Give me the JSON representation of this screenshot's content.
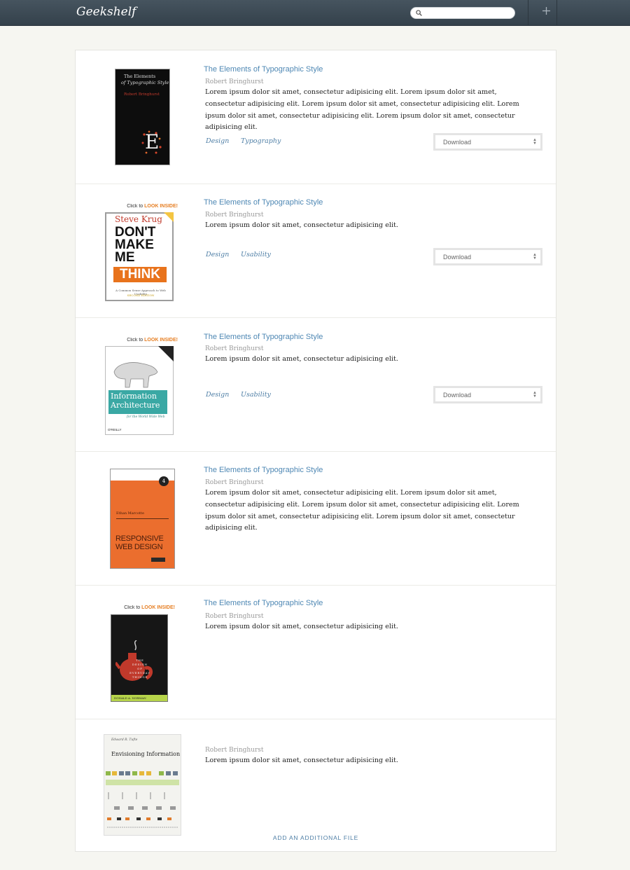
{
  "header": {
    "logo": "Geekshelf",
    "search_placeholder": "",
    "add_icon": "plus-icon",
    "search_icon": "search-icon"
  },
  "books": [
    {
      "title": "The Elements of Typographic Style",
      "author": "Robert Bringhurst",
      "description": "Lorem ipsum dolor sit amet, consectetur adipisicing elit. Lorem ipsum dolor sit amet, consectetur adipisicing elit. Lorem ipsum dolor sit amet, consectetur adipisicing elit. Lorem ipsum dolor sit amet, consectetur adipisicing elit. Lorem ipsum dolor sit amet, consectetur adipisicing elit.",
      "tags": [
        "Design",
        "Typography"
      ],
      "download_label": "Download",
      "cover": {
        "title_line1": "The Elements",
        "title_line2": "of Typographic Style",
        "author": "Robert Bringhurst"
      }
    },
    {
      "title": "The Elements of Typographic Style",
      "author": "Robert Bringhurst",
      "description": "Lorem ipsum dolor sit amet, consectetur adipisicing elit.",
      "tags": [
        "Design",
        "Usability"
      ],
      "download_label": "Download",
      "cover": {
        "banner_prefix": "Click to ",
        "banner_highlight": "LOOK INSIDE!",
        "author": "Steve Krug",
        "line1": "DON'T",
        "line2": "MAKE",
        "line3": "ME",
        "line4": "THINK",
        "subtitle": "A Common Sense Approach to Web Usability",
        "edition": "SECOND EDITION"
      }
    },
    {
      "title": "The Elements of Typographic Style",
      "author": "Robert Bringhurst",
      "description": "Lorem ipsum dolor sit amet, consectetur adipisicing elit.",
      "tags": [
        "Design",
        "Usability"
      ],
      "download_label": "Download",
      "cover": {
        "banner_prefix": "Click to ",
        "banner_highlight": "LOOK INSIDE!",
        "line1": "Information",
        "line2": "Architecture",
        "subtitle": "for the World Wide Web",
        "publisher": "O'REILLY"
      }
    },
    {
      "title": "The Elements of Typographic Style",
      "author": "Robert Bringhurst",
      "description": "Lorem ipsum dolor sit amet, consectetur adipisicing elit. Lorem ipsum dolor sit amet, consectetur adipisicing elit. Lorem ipsum dolor sit amet, consectetur adipisicing elit. Lorem ipsum dolor sit amet, consectetur adipisicing elit. Lorem ipsum dolor sit amet, consectetur adipisicing elit.",
      "tags": [],
      "download_label": "",
      "cover": {
        "badge": "4",
        "author": "Ethan Marcotte",
        "line1": "RESPONSIVE",
        "line2": "WEB DESIGN"
      }
    },
    {
      "title": "The Elements of Typographic Style",
      "author": "Robert Bringhurst",
      "description": "Lorem ipsum dolor sit amet, consectetur adipisicing elit.",
      "tags": [],
      "download_label": "",
      "cover": {
        "banner_prefix": "Click to ",
        "banner_highlight": "LOOK INSIDE!",
        "vertical_text": "THE DESIGN OF EVERYDAY THINGS",
        "author": "DONALD A. NORMAN"
      }
    },
    {
      "title": "",
      "author": "Robert Bringhurst",
      "description": "Lorem ipsum dolor sit amet, consectetur adipisicing elit.",
      "tags": [],
      "download_label": "",
      "cover": {
        "author": "Edward R. Tufte",
        "title": "Envisioning Information"
      }
    }
  ],
  "add_file_label": "ADD AN ADDITIONAL FILE",
  "colors": {
    "header_bg": "#3d4a55",
    "link_blue": "#4f88b4",
    "page_bg": "#f6f6f1"
  }
}
